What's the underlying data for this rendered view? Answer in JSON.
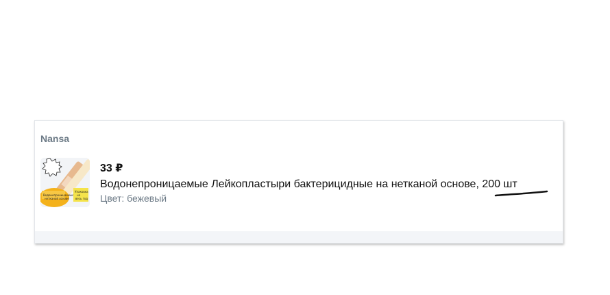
{
  "order_item": {
    "seller": "Nansa",
    "price": "33 ₽",
    "title": "Водонепроницаемые Лейкопластыри бактерицидные на нетканой основе, 200 шт",
    "color_label": "Цвет: бежевый"
  },
  "thumbnail": {
    "icon": "bandage-package-image",
    "badge_left": "Водонепроницаемые",
    "badge_right": "Упаковка"
  },
  "colors": {
    "seller": "#6c7a86",
    "text": "#111111",
    "muted": "#6c7a86",
    "annotation": "#111111"
  }
}
